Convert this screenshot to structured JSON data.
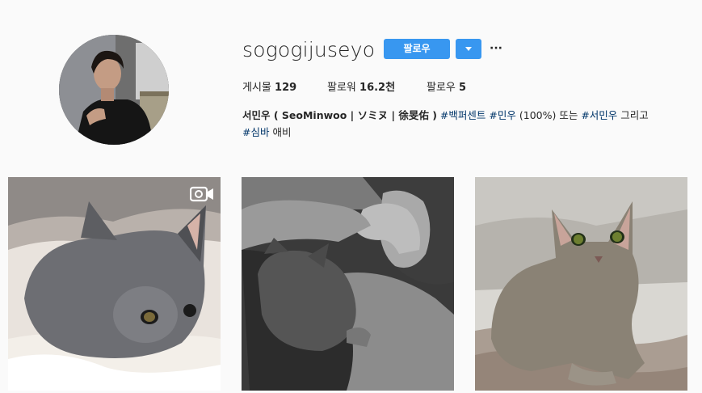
{
  "profile": {
    "username": "sogogijuseyo",
    "follow_label": "팔로우",
    "more_label": "···",
    "stats": {
      "posts_label": "게시물",
      "posts_value": "129",
      "followers_label": "팔로워",
      "followers_value": "16.2천",
      "following_label": "팔로우",
      "following_value": "5"
    },
    "bio": {
      "name": "서민우 ( SeoMinwoo | ソミヌ | 徐旻佑 )",
      "tag1": "#백퍼센트",
      "tag2": "#민우",
      "text1": "(100%) 또는",
      "tag3": "#서민우",
      "text2": "그리고",
      "tag4": "#심바",
      "text3": "애비"
    }
  },
  "posts": [
    {
      "subject": "gray cat on white blanket",
      "video": true
    },
    {
      "subject": "man with cat, black and white",
      "video": false
    },
    {
      "subject": "gray cat sitting on bed",
      "video": false
    }
  ],
  "colors": {
    "accent": "#3897f0",
    "hashtag": "#003569",
    "background": "#fafafa"
  }
}
